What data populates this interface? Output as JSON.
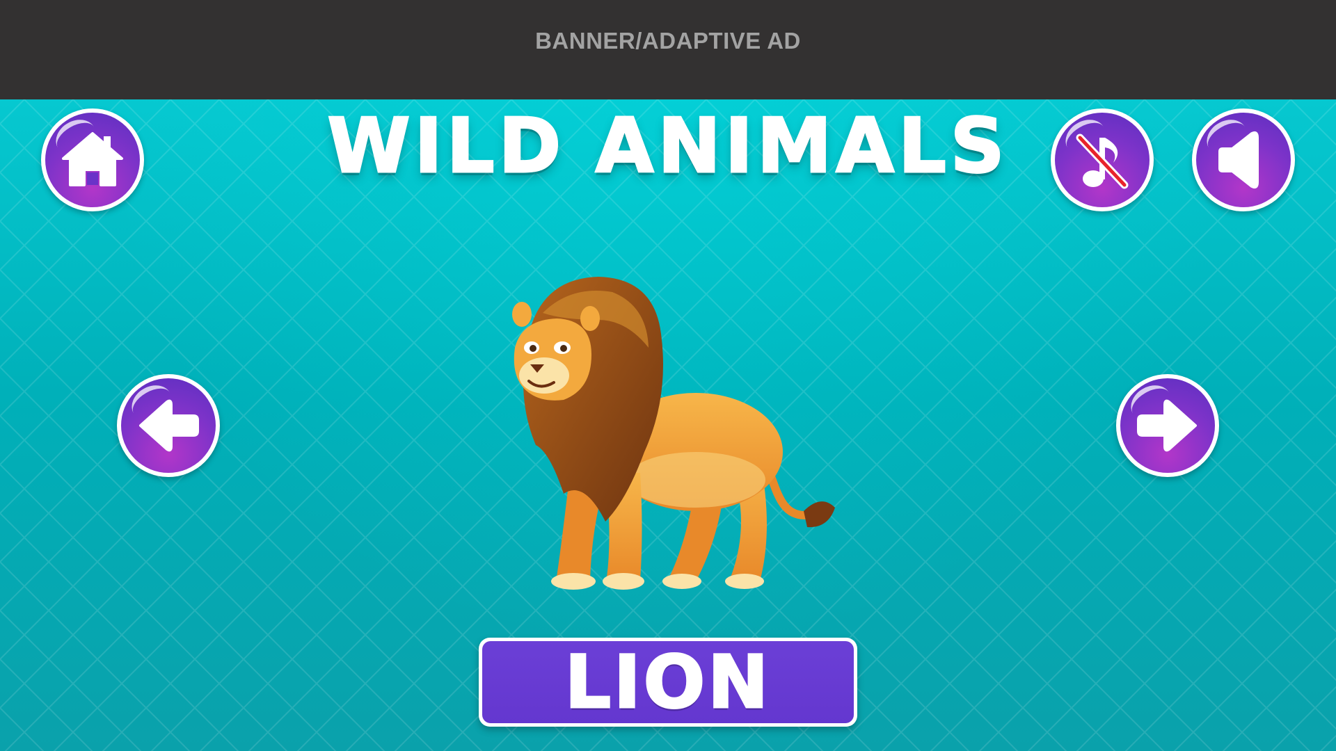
{
  "ad": {
    "label": "BANNER/ADAPTIVE AD"
  },
  "header": {
    "title": "WILD ANIMALS"
  },
  "buttons": {
    "home": {
      "icon": "home-icon"
    },
    "music": {
      "icon": "music-muted-icon",
      "state": "muted"
    },
    "sound": {
      "icon": "speaker-icon"
    },
    "previous": {
      "icon": "arrow-left-icon"
    },
    "next": {
      "icon": "arrow-right-icon"
    }
  },
  "animal": {
    "name": "LION",
    "image": "lion-illustration"
  },
  "colors": {
    "background": "#00b7bf",
    "button_purple": "#6b3fd6",
    "banner": "#333131"
  }
}
